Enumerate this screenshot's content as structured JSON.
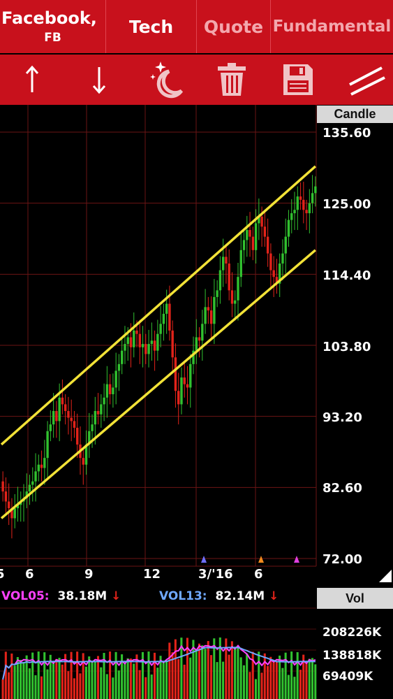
{
  "header": {
    "tabs": [
      {
        "title": "Facebook,",
        "subtitle": "FB"
      },
      {
        "title": "Tech"
      },
      {
        "title": "Quote"
      },
      {
        "title": "Fundamental"
      }
    ]
  },
  "toolbar": {
    "tools": [
      "arrow-up-icon",
      "arrow-down-icon",
      "night-mode-icon",
      "trash-icon",
      "save-icon",
      "drawing-lines-icon"
    ]
  },
  "colors": {
    "bar_red": "#c8111c",
    "bull": "#31c12f",
    "bear": "#e2231a",
    "trendline": "#f2e237",
    "vol05": "#ff40ff",
    "vol13": "#6fa8ff"
  },
  "price_chart": {
    "label": "Candle",
    "y_ticks": [
      "135.60",
      "125.00",
      "114.40",
      "103.80",
      "93.20",
      "82.60",
      "72.00"
    ],
    "x_ticks": [
      "5",
      "6",
      "9",
      "12",
      "3/'16",
      "6"
    ]
  },
  "chart_data": {
    "type": "candlestick",
    "ylim": [
      72.0,
      135.6
    ],
    "y_ticks": [
      135.6,
      125.0,
      114.4,
      103.8,
      93.2,
      82.6,
      72.0
    ],
    "closes": [
      82.0,
      80.5,
      79.5,
      78.0,
      79.5,
      80.0,
      80.5,
      81.0,
      82.0,
      83.0,
      83.5,
      85.0,
      86.0,
      85.5,
      87.0,
      91.0,
      92.0,
      94.0,
      92.5,
      96.0,
      95.0,
      94.0,
      93.0,
      92.5,
      91.5,
      89.0,
      87.0,
      86.0,
      89.0,
      91.0,
      92.0,
      94.0,
      93.5,
      95.0,
      96.0,
      98.0,
      96.5,
      97.5,
      100.0,
      101.0,
      103.0,
      104.0,
      105.0,
      103.5,
      106.0,
      105.5,
      103.5,
      104.0,
      102.5,
      104.0,
      104.5,
      103.0,
      105.5,
      107.0,
      108.5,
      110.0,
      106.0,
      102.0,
      97.0,
      95.0,
      99.0,
      98.0,
      97.5,
      101.0,
      103.0,
      105.0,
      104.5,
      107.0,
      109.5,
      109.0,
      107.0,
      111.0,
      112.0,
      115.0,
      117.0,
      116.0,
      112.0,
      110.0,
      110.5,
      114.0,
      118.0,
      119.5,
      121.0,
      120.0,
      118.0,
      122.0,
      123.0,
      121.5,
      120.0,
      117.5,
      115.0,
      114.0,
      113.0,
      116.0,
      117.5,
      120.0,
      122.5,
      123.5,
      124.0,
      126.0,
      125.5,
      124.0,
      123.5,
      125.0,
      126.5,
      127.5
    ],
    "trend_channel": {
      "upper": [
        {
          "x": 0,
          "y": 89.0
        },
        {
          "x": 104,
          "y": 130.5
        }
      ],
      "lower": [
        {
          "x": 0,
          "y": 78.0
        },
        {
          "x": 104,
          "y": 118.0
        }
      ]
    },
    "volume_ticks": [
      "208226K",
      "138818K",
      "69409K"
    ]
  },
  "volume_panel": {
    "label": "Vol",
    "vol05_label": "VOL05:",
    "vol05_value": "38.18M",
    "vol13_label": "VOL13:",
    "vol13_value": "82.14M",
    "y_ticks": [
      "208226K",
      "138818K",
      "69409K"
    ]
  }
}
